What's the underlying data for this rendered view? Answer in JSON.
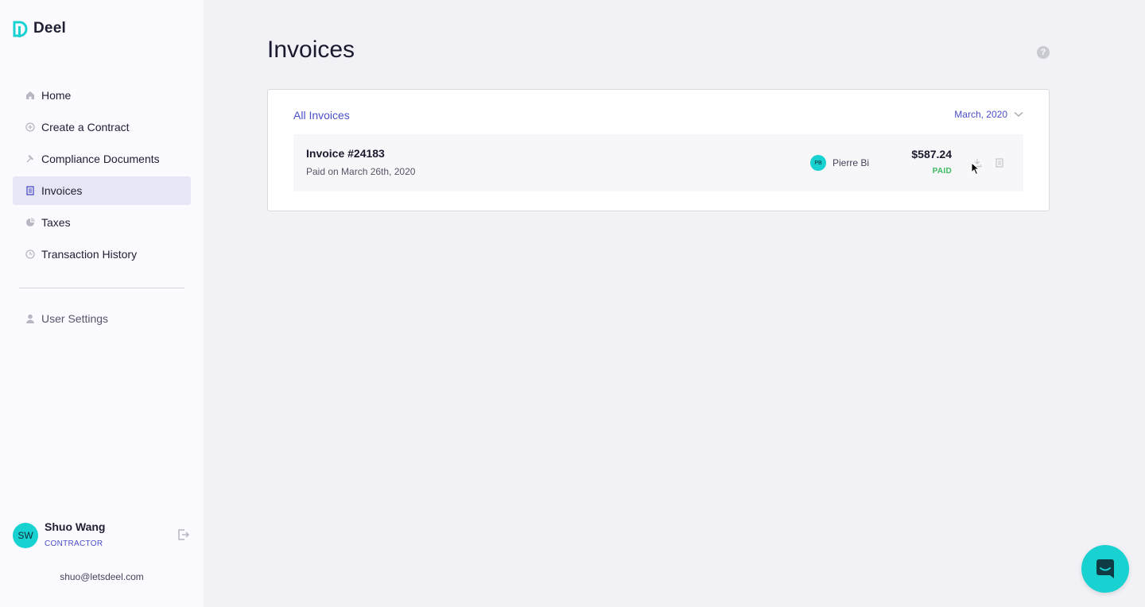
{
  "app": {
    "logo_text": "Deel",
    "brand_color": "#18d1d1",
    "accent_color": "#4a4fc7"
  },
  "sidebar": {
    "items": [
      {
        "label": "Home",
        "icon": "home-icon"
      },
      {
        "label": "Create a Contract",
        "icon": "plus-circle-icon"
      },
      {
        "label": "Compliance Documents",
        "icon": "gavel-icon"
      },
      {
        "label": "Invoices",
        "icon": "document-icon",
        "active": true
      },
      {
        "label": "Taxes",
        "icon": "pie-chart-icon"
      },
      {
        "label": "Transaction History",
        "icon": "clock-icon"
      }
    ],
    "settings_label": "User Settings"
  },
  "user": {
    "initials": "SW",
    "name": "Shuo Wang",
    "role": "CONTRACTOR",
    "email": "shuo@letsdeel.com"
  },
  "page": {
    "title": "Invoices"
  },
  "card": {
    "tab_label": "All Invoices",
    "month_filter": "March, 2020",
    "invoices": [
      {
        "title": "Invoice #24183",
        "subtitle": "Paid on March 26th, 2020",
        "client_initials": "PB",
        "client_name": "Pierre Bi",
        "amount": "$587.24",
        "status": "PAID",
        "status_color": "#3dbb63"
      }
    ]
  }
}
